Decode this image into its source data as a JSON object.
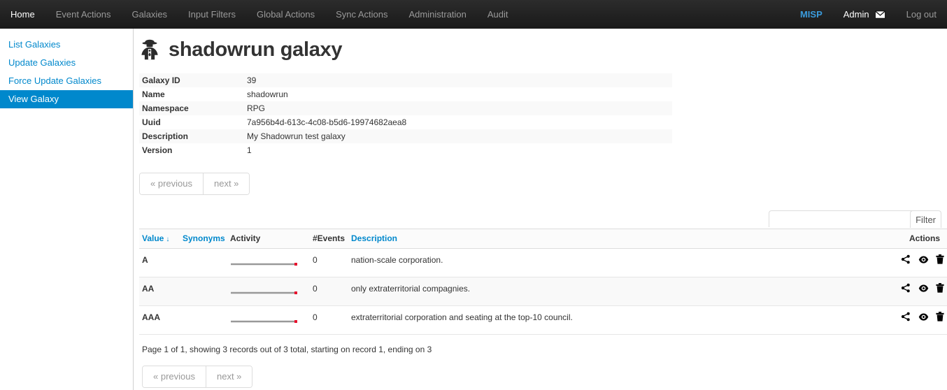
{
  "navbar": {
    "left_items": [
      {
        "label": "Home",
        "name": "nav-home"
      },
      {
        "label": "Event Actions",
        "name": "nav-event-actions"
      },
      {
        "label": "Galaxies",
        "name": "nav-galaxies"
      },
      {
        "label": "Input Filters",
        "name": "nav-input-filters"
      },
      {
        "label": "Global Actions",
        "name": "nav-global-actions"
      },
      {
        "label": "Sync Actions",
        "name": "nav-sync-actions"
      },
      {
        "label": "Administration",
        "name": "nav-administration"
      },
      {
        "label": "Audit",
        "name": "nav-audit"
      }
    ],
    "brand": "MISP",
    "user": "Admin",
    "logout": "Log out",
    "brand_color": "#3a9bdc",
    "background": "#191919"
  },
  "sidebar": {
    "items": [
      {
        "label": "List Galaxies",
        "active": false
      },
      {
        "label": "Update Galaxies",
        "active": false
      },
      {
        "label": "Force Update Galaxies",
        "active": false
      },
      {
        "label": "View Galaxy",
        "active": true
      }
    ],
    "active_color": "#0088cc",
    "link_color": "#0088cc"
  },
  "page": {
    "title": "shadowrun galaxy",
    "icon": "user-secret-icon"
  },
  "details": {
    "rows": [
      {
        "key": "Galaxy ID",
        "value": "39"
      },
      {
        "key": "Name",
        "value": "shadowrun"
      },
      {
        "key": "Namespace",
        "value": "RPG"
      },
      {
        "key": "Uuid",
        "value": "7a956b4d-613c-4c08-b5d6-19974682aea8"
      },
      {
        "key": "Description",
        "value": "My Shadowrun test galaxy"
      },
      {
        "key": "Version",
        "value": "1"
      }
    ]
  },
  "pager": {
    "previous": "« previous",
    "next": "next »"
  },
  "filter": {
    "value": "",
    "placeholder": "",
    "button_label": "Filter"
  },
  "table": {
    "headers": [
      {
        "label": "Value",
        "sortable": true,
        "sort_indicator": "↓",
        "style": "link"
      },
      {
        "label": "Synonyms",
        "sortable": true,
        "style": "link"
      },
      {
        "label": "Activity",
        "sortable": false,
        "style": "plain"
      },
      {
        "label": "#Events",
        "sortable": false,
        "style": "plain"
      },
      {
        "label": "Description",
        "sortable": true,
        "style": "link"
      },
      {
        "label": "Actions",
        "sortable": false,
        "style": "actions"
      }
    ],
    "rows": [
      {
        "value": "A",
        "synonyms": "",
        "activity": {
          "type": "sparkline",
          "points": [
            0,
            0,
            0,
            0,
            0,
            0,
            0
          ],
          "marker": "red-dot"
        },
        "events": "0",
        "description": "nation-scale corporation.",
        "actions": [
          "share-icon",
          "eye-icon",
          "trash-icon"
        ]
      },
      {
        "value": "AA",
        "synonyms": "",
        "activity": {
          "type": "sparkline",
          "points": [
            0,
            0,
            0,
            0,
            0,
            0,
            0
          ],
          "marker": "red-dot"
        },
        "events": "0",
        "description": "only extraterritorial compagnies.",
        "actions": [
          "share-icon",
          "eye-icon",
          "trash-icon"
        ]
      },
      {
        "value": "AAA",
        "synonyms": "",
        "activity": {
          "type": "sparkline",
          "points": [
            0,
            0,
            0,
            0,
            0,
            0,
            0
          ],
          "marker": "red-dot"
        },
        "events": "0",
        "description": "extraterritorial corporation and seating at the top-10 council.",
        "actions": [
          "share-icon",
          "eye-icon",
          "trash-icon"
        ]
      }
    ],
    "record_counter": "Page 1 of 1, showing 3 records out of 3 total, starting on record 1, ending on 3",
    "sparkline_line_color": "#999999",
    "sparkline_marker_color": "#e8112d"
  }
}
